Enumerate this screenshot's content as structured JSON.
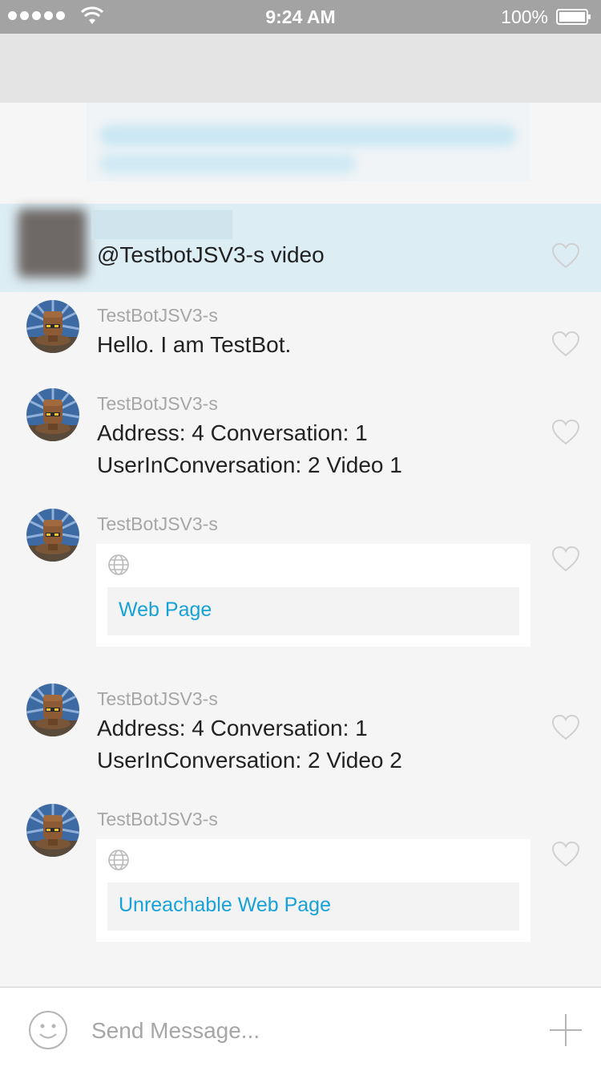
{
  "status_bar": {
    "time": "9:24 AM",
    "battery": "100%",
    "icons": [
      "signal-icon",
      "wifi-icon",
      "battery-icon"
    ]
  },
  "colors": {
    "accent_link": "#16a2d8",
    "selected_row": "#dcedf4",
    "sender_gray": "#a6a6a6"
  },
  "mention": {
    "text": "@TestbotJSV3-s video"
  },
  "messages": [
    {
      "sender": "TestBotJSV3-s",
      "lines": [
        "Hello. I am TestBot."
      ]
    },
    {
      "sender": "TestBotJSV3-s",
      "lines": [
        "Address: 4 Conversation: 1",
        "UserInConversation: 2 Video 1"
      ]
    },
    {
      "sender": "TestBotJSV3-s",
      "card_link": "Web Page"
    },
    {
      "sender": "TestBotJSV3-s",
      "lines": [
        "Address: 4 Conversation: 1",
        "UserInConversation: 2 Video 2"
      ]
    },
    {
      "sender": "TestBotJSV3-s",
      "card_link": "Unreachable Web Page"
    }
  ],
  "composer": {
    "placeholder": "Send Message..."
  }
}
